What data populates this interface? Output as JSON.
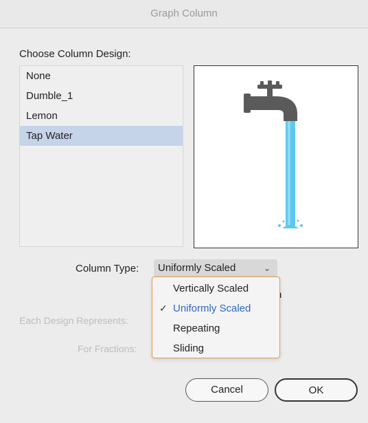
{
  "window": {
    "title": "Graph Column"
  },
  "design_list": {
    "label": "Choose Column Design:",
    "items": [
      {
        "label": "None",
        "selected": false
      },
      {
        "label": "Dumble_1",
        "selected": false
      },
      {
        "label": "Lemon",
        "selected": false
      },
      {
        "label": "Tap Water",
        "selected": true
      }
    ]
  },
  "preview": {
    "icon": "tap-water-icon",
    "pipe_color": "#5a5a5a",
    "water_color": "#5cc8ef"
  },
  "column_type": {
    "label": "Column Type:",
    "value": "Uniformly Scaled",
    "options": [
      {
        "label": "Vertically Scaled",
        "checked": false
      },
      {
        "label": "Uniformly Scaled",
        "checked": true
      },
      {
        "label": "Repeating",
        "checked": false
      },
      {
        "label": "Sliding",
        "checked": false
      }
    ]
  },
  "hidden_partial_text": "n",
  "each_design_represents": {
    "label": "Each Design Represents:"
  },
  "for_fractions": {
    "label": "For Fractions:"
  },
  "buttons": {
    "cancel": "Cancel",
    "ok": "OK"
  },
  "colors": {
    "accent": "#e79a42",
    "selected_text": "#2b67c9",
    "list_selection": "#c6d4ea"
  }
}
